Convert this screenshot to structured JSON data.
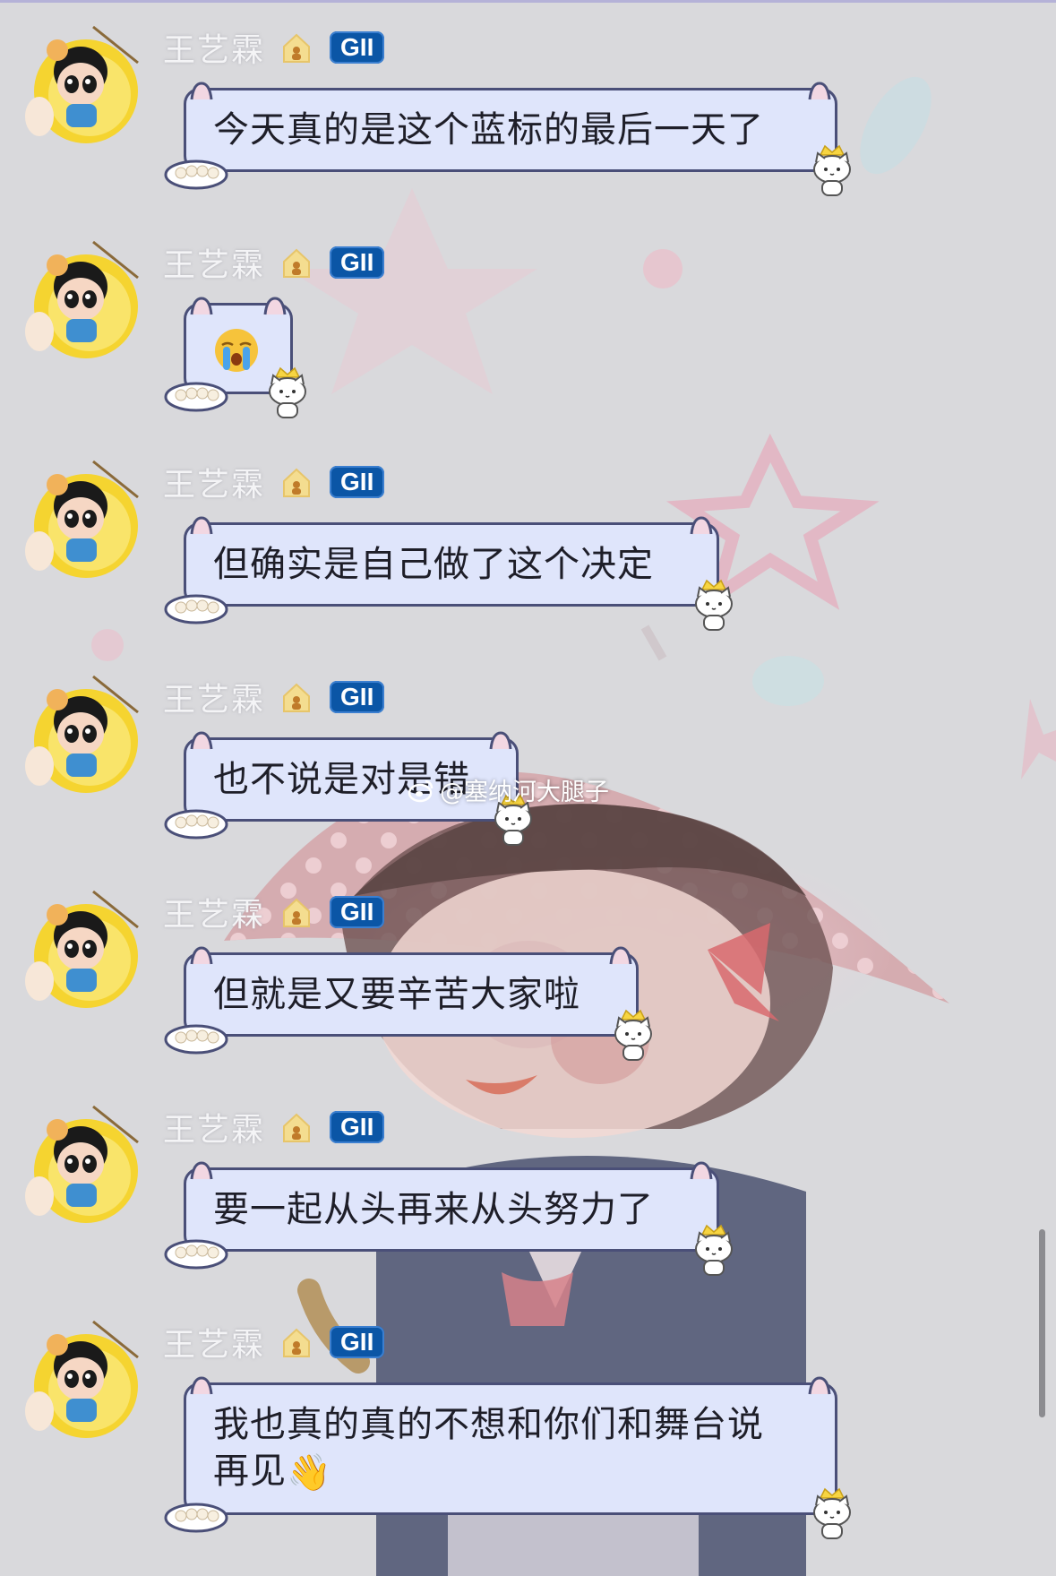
{
  "messages": [
    {
      "sender": "王艺霖",
      "level_badge": "GII",
      "text": "今天真的是这个蓝标的最后一天了",
      "emoji": ""
    },
    {
      "sender": "王艺霖",
      "level_badge": "GII",
      "text": "",
      "emoji": "crying-face"
    },
    {
      "sender": "王艺霖",
      "level_badge": "GII",
      "text": "但确实是自己做了这个决定",
      "emoji": ""
    },
    {
      "sender": "王艺霖",
      "level_badge": "GII",
      "text": "也不说是对是错",
      "emoji": ""
    },
    {
      "sender": "王艺霖",
      "level_badge": "GII",
      "text": "但就是又要辛苦大家啦",
      "emoji": ""
    },
    {
      "sender": "王艺霖",
      "level_badge": "GII",
      "text": "要一起从头再来从头努力了",
      "emoji": ""
    },
    {
      "sender": "王艺霖",
      "level_badge": "GII",
      "text": "我也真的真的不想和你们和舞台说",
      "text_line2": "再见",
      "emoji": "waving-hand"
    }
  ],
  "watermark": {
    "text": "@塞纳河大腿子",
    "icon": "weibo-icon"
  },
  "colors": {
    "bubble_fill": "#dfe5fb",
    "bubble_border": "#4a4f78",
    "badge_blue": "#0b56a6",
    "background": "#d9d9dc"
  }
}
